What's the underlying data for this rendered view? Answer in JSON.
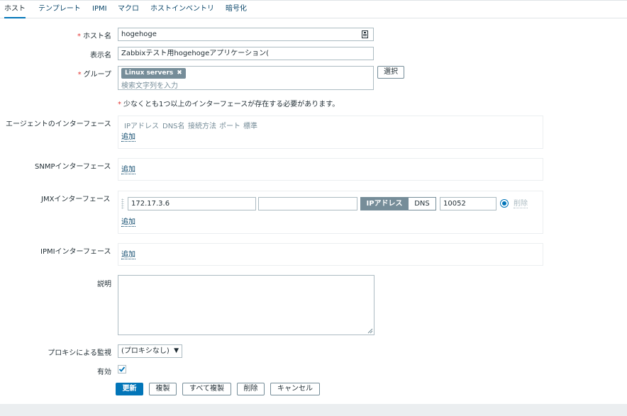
{
  "tabs": [
    {
      "label": "ホスト"
    },
    {
      "label": "テンプレート"
    },
    {
      "label": "IPMI"
    },
    {
      "label": "マクロ"
    },
    {
      "label": "ホストインベントリ"
    },
    {
      "label": "暗号化"
    }
  ],
  "form": {
    "hostname": {
      "label": "ホスト名",
      "value": "hogehoge"
    },
    "visible_name": {
      "label": "表示名",
      "value": "Zabbixテスト用hogehogeアプリケーション("
    },
    "groups": {
      "label": "グループ",
      "tag": "Linux servers",
      "tag_remove": "✖",
      "placeholder": "検索文字列を入力",
      "select_button": "選択"
    },
    "required_marker": "*",
    "notice": "少なくとも1つ以上のインターフェースが存在する必要があります。",
    "agent_interfaces": {
      "label": "エージェントのインターフェース",
      "columns": [
        "IPアドレス",
        "DNS名",
        "接続方法",
        "ポート",
        "標準"
      ],
      "add": "追加"
    },
    "snmp_interfaces": {
      "label": "SNMPインターフェース",
      "add": "追加"
    },
    "jmx_interfaces": {
      "label": "JMXインターフェース",
      "ip": "172.17.3.6",
      "dns": "",
      "connect_ip": "IPアドレス",
      "connect_dns": "DNS",
      "port": "10052",
      "default_selected": true,
      "remove": "削除",
      "add": "追加"
    },
    "ipmi_interfaces": {
      "label": "IPMIインターフェース",
      "add": "追加"
    },
    "description": {
      "label": "説明",
      "value": ""
    },
    "proxy": {
      "label": "プロキシによる監視",
      "selected": "(プロキシなし)"
    },
    "enabled": {
      "label": "有効",
      "checked": true
    }
  },
  "buttons": {
    "update": "更新",
    "clone": "複製",
    "full_clone": "すべて複製",
    "delete": "削除",
    "cancel": "キャンセル"
  },
  "icons": {
    "hostname_field": "id-card-icon",
    "tag_remove": "close-icon",
    "checkbox": "checkmark-icon",
    "select": "caret-down-icon",
    "drag": "drag-handle-icon"
  },
  "colors": {
    "accent": "#0275b8",
    "link": "#0a466a",
    "required": "#e33734",
    "tag_bg": "#768d99",
    "border": "#acbbc2"
  }
}
